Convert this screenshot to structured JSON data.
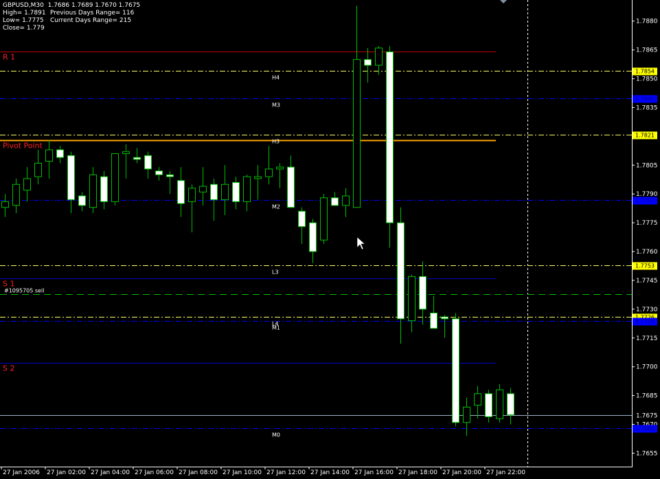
{
  "header": {
    "line1": "GBPUSD,M30  1.7686 1.7689 1.7670 1.7675",
    "high": "High= 1.7891",
    "prev_range": "Previous Days Range= 116",
    "low": "Low= 1.7775",
    "cur_range": "Current Days Range= 215",
    "close": "Close= 1.779"
  },
  "colors": {
    "bg": "#000000",
    "bull_fill": "#000000",
    "bear_fill": "#ffffff",
    "candle_stroke": "#00c000",
    "axis": "#ffffff",
    "r_level": "#c00000",
    "pivot": "#ffa500",
    "s_level": "#0000c0",
    "h_l_dash": "#ffff66",
    "m_dash": "#0000ff",
    "order": "#00c000",
    "price_line": "#a0b4c8",
    "label_red": "#ff2020"
  },
  "order_label": "#1095705 sell",
  "chart_data": {
    "type": "candlestick",
    "ylim": [
      1.7648,
      1.7891
    ],
    "yticks": [
      "1.7880",
      "1.7865",
      "1.7850",
      "1.7835",
      "1.7820",
      "1.7805",
      "1.7790",
      "1.7775",
      "1.7760",
      "1.7745",
      "1.7730",
      "1.7715",
      "1.7700",
      "1.7685",
      "1.7670",
      "1.7655"
    ],
    "xticks": [
      "27 Jan 2006",
      "27 Jan 02:00",
      "27 Jan 04:00",
      "27 Jan 06:00",
      "27 Jan 08:00",
      "27 Jan 10:00",
      "27 Jan 12:00",
      "27 Jan 14:00",
      "27 Jan 16:00",
      "27 Jan 18:00",
      "27 Jan 20:00",
      "27 Jan 22:00"
    ],
    "candles": [
      {
        "o": 1.7783,
        "h": 1.779,
        "l": 1.7778,
        "c": 1.7786
      },
      {
        "o": 1.7784,
        "h": 1.7798,
        "l": 1.778,
        "c": 1.7795
      },
      {
        "o": 1.7792,
        "h": 1.7804,
        "l": 1.7786,
        "c": 1.7798
      },
      {
        "o": 1.7799,
        "h": 1.7813,
        "l": 1.7795,
        "c": 1.7806
      },
      {
        "o": 1.7807,
        "h": 1.7818,
        "l": 1.7798,
        "c": 1.7813
      },
      {
        "o": 1.7813,
        "h": 1.7815,
        "l": 1.7806,
        "c": 1.7809
      },
      {
        "o": 1.781,
        "h": 1.7812,
        "l": 1.778,
        "c": 1.7787
      },
      {
        "o": 1.7789,
        "h": 1.7791,
        "l": 1.7781,
        "c": 1.7784
      },
      {
        "o": 1.7783,
        "h": 1.7804,
        "l": 1.778,
        "c": 1.78
      },
      {
        "o": 1.7799,
        "h": 1.7802,
        "l": 1.7782,
        "c": 1.7786
      },
      {
        "o": 1.7786,
        "h": 1.7811,
        "l": 1.7784,
        "c": 1.7811
      },
      {
        "o": 1.7811,
        "h": 1.7816,
        "l": 1.7798,
        "c": 1.7812
      },
      {
        "o": 1.7809,
        "h": 1.7814,
        "l": 1.7806,
        "c": 1.7808
      },
      {
        "o": 1.781,
        "h": 1.7812,
        "l": 1.7798,
        "c": 1.7803
      },
      {
        "o": 1.7802,
        "h": 1.7804,
        "l": 1.7797,
        "c": 1.78
      },
      {
        "o": 1.78,
        "h": 1.7802,
        "l": 1.779,
        "c": 1.7799
      },
      {
        "o": 1.7797,
        "h": 1.7804,
        "l": 1.7778,
        "c": 1.7785
      },
      {
        "o": 1.7786,
        "h": 1.7795,
        "l": 1.777,
        "c": 1.7793
      },
      {
        "o": 1.7791,
        "h": 1.7804,
        "l": 1.7784,
        "c": 1.7794
      },
      {
        "o": 1.7795,
        "h": 1.7798,
        "l": 1.7776,
        "c": 1.7787
      },
      {
        "o": 1.7787,
        "h": 1.7805,
        "l": 1.7779,
        "c": 1.7795
      },
      {
        "o": 1.7796,
        "h": 1.7799,
        "l": 1.7782,
        "c": 1.7786
      },
      {
        "o": 1.7786,
        "h": 1.78,
        "l": 1.7781,
        "c": 1.7799
      },
      {
        "o": 1.7798,
        "h": 1.7805,
        "l": 1.7787,
        "c": 1.7799
      },
      {
        "o": 1.7799,
        "h": 1.7815,
        "l": 1.7795,
        "c": 1.7803
      },
      {
        "o": 1.7803,
        "h": 1.7806,
        "l": 1.7793,
        "c": 1.7804
      },
      {
        "o": 1.7804,
        "h": 1.781,
        "l": 1.7785,
        "c": 1.7783
      },
      {
        "o": 1.7781,
        "h": 1.7783,
        "l": 1.7764,
        "c": 1.7773
      },
      {
        "o": 1.7775,
        "h": 1.7777,
        "l": 1.7754,
        "c": 1.776
      },
      {
        "o": 1.7766,
        "h": 1.779,
        "l": 1.7764,
        "c": 1.7788
      },
      {
        "o": 1.7788,
        "h": 1.7791,
        "l": 1.7784,
        "c": 1.7784
      },
      {
        "o": 1.7784,
        "h": 1.7793,
        "l": 1.7778,
        "c": 1.7789
      },
      {
        "o": 1.7783,
        "h": 1.7888,
        "l": 1.7783,
        "c": 1.786
      },
      {
        "o": 1.786,
        "h": 1.7866,
        "l": 1.7848,
        "c": 1.7857
      },
      {
        "o": 1.7857,
        "h": 1.7867,
        "l": 1.7852,
        "c": 1.7866
      },
      {
        "o": 1.7864,
        "h": 1.7867,
        "l": 1.7762,
        "c": 1.7775
      },
      {
        "o": 1.7775,
        "h": 1.7783,
        "l": 1.7712,
        "c": 1.7725
      },
      {
        "o": 1.7724,
        "h": 1.7748,
        "l": 1.7718,
        "c": 1.7747
      },
      {
        "o": 1.7747,
        "h": 1.7755,
        "l": 1.7722,
        "c": 1.773
      },
      {
        "o": 1.7728,
        "h": 1.7737,
        "l": 1.7721,
        "c": 1.772
      },
      {
        "o": 1.7726,
        "h": 1.7727,
        "l": 1.7715,
        "c": 1.7725
      },
      {
        "o": 1.7725,
        "h": 1.7728,
        "l": 1.7669,
        "c": 1.7671
      },
      {
        "o": 1.7671,
        "h": 1.7684,
        "l": 1.7664,
        "c": 1.7679
      },
      {
        "o": 1.768,
        "h": 1.769,
        "l": 1.7673,
        "c": 1.7686
      },
      {
        "o": 1.7686,
        "h": 1.7688,
        "l": 1.7671,
        "c": 1.7674
      },
      {
        "o": 1.7673,
        "h": 1.7691,
        "l": 1.7671,
        "c": 1.7688
      },
      {
        "o": 1.7686,
        "h": 1.7689,
        "l": 1.767,
        "c": 1.7675
      }
    ],
    "levels": [
      {
        "name": "R 1",
        "value": 1.7864,
        "kind": "r"
      },
      {
        "name": "Pivot Point",
        "value": 1.7818,
        "kind": "pivot"
      },
      {
        "name": "S 1",
        "value": 1.7746,
        "kind": "s"
      },
      {
        "name": "S 2",
        "value": 1.7702,
        "kind": "s"
      }
    ],
    "camarilla": [
      {
        "name": "H4",
        "value": 1.7854,
        "kind": "h",
        "badge": "1.7854"
      },
      {
        "name": "M3",
        "value": 1.784,
        "kind": "m",
        "badge": "1.7840"
      },
      {
        "name": "H3",
        "value": 1.7821,
        "kind": "h",
        "badge": "1.7821"
      },
      {
        "name": "M2",
        "value": 1.7787,
        "kind": "m",
        "badge": "1.7787"
      },
      {
        "name": "L3",
        "value": 1.7753,
        "kind": "h",
        "badge": "1.7753"
      },
      {
        "name": "L4",
        "value": 1.7726,
        "kind": "h",
        "badge": "1.7726"
      },
      {
        "name": "M1",
        "value": 1.7724,
        "kind": "m",
        "badge": "1.7724"
      },
      {
        "name": "M0",
        "value": 1.7668,
        "kind": "m",
        "badge": "1.7668"
      }
    ],
    "order_level": 1.7738,
    "current_price": 1.7675,
    "current_label": "1.7675"
  }
}
